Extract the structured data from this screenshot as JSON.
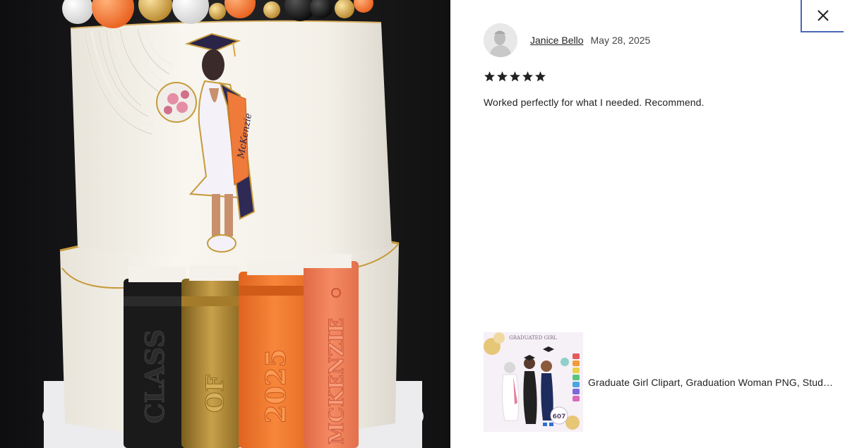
{
  "photo": {
    "alt": "Two-tier graduation cake photo",
    "cake_text": {
      "sash_name": "McKenzie",
      "book_1": "CLASS",
      "book_2": "OF",
      "book_3": "2025",
      "book_4": "MCKENZIE"
    }
  },
  "close_label": "Close",
  "review": {
    "reviewer_name": "Janice Bello",
    "date": "May 28, 2025",
    "rating": 5,
    "stars_text": "★★★★★",
    "text": "Worked perfectly for what I needed. Recommend."
  },
  "item": {
    "title": "Graduate Girl Clipart, Graduation Woman PNG, Student Graduation Clipart",
    "thumb_heading": "GRADUATED GIRL",
    "thumb_count": "607"
  },
  "colors": {
    "star": "#222222",
    "close_border": "#4a67b8",
    "orange": "#f0792c"
  }
}
